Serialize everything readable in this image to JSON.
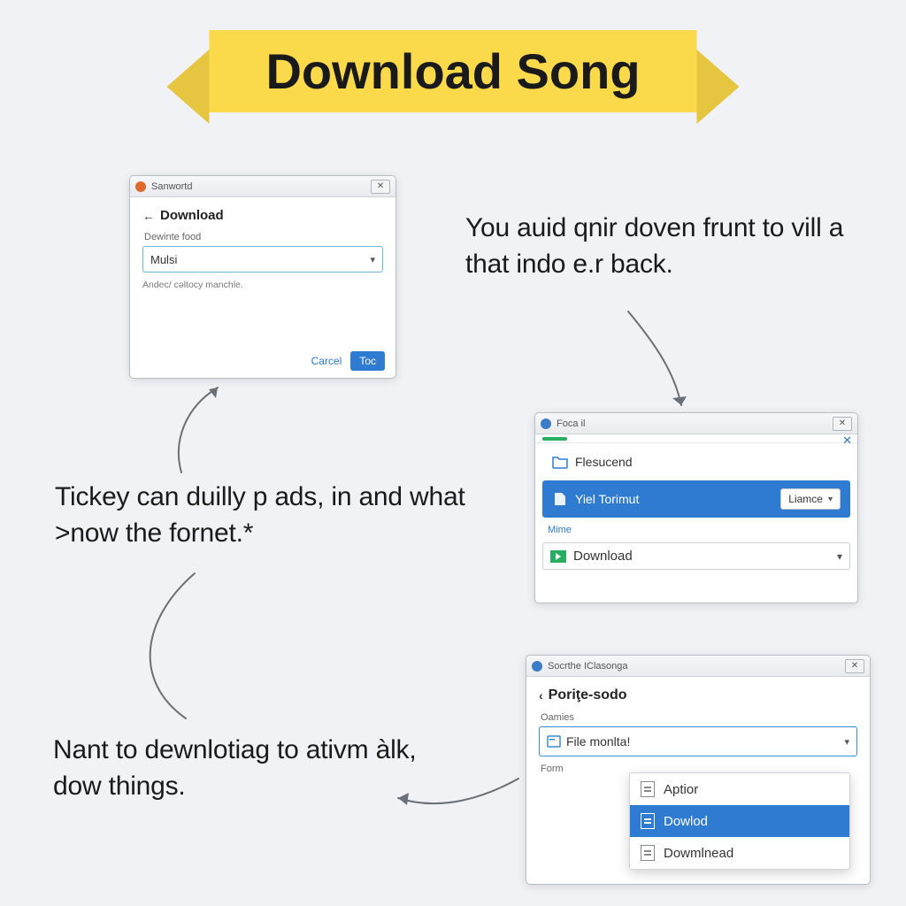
{
  "banner": {
    "title": "Download Song"
  },
  "captions": {
    "c1": "You auid qnir doven frunt to vill a that indo e.r back.",
    "c2": "Tickey can duilly p ads, in and what >now the fornet.*",
    "c3": "Nant to dewnlotiag to ativm àlk, dow things."
  },
  "win1": {
    "app_title": "Sanwortd",
    "back_label": "Download",
    "field_label": "Dewinte food",
    "select_value": "Mulsi",
    "hint": "Andec/ cəltocy manchle.",
    "cancel_label": "Carcel",
    "ok_label": "Toc"
  },
  "win2": {
    "app_title": "Foca il",
    "row1_label": "Flesucend",
    "row2_label": "Yiel Torimut",
    "chip_label": "Liamce",
    "link_label": "Mime",
    "download_label": "Download"
  },
  "win3": {
    "app_title": "Socrthe IClasonga",
    "crumb_label": "Poriţe-sodo",
    "field1_label": "Oamies",
    "select_value": "File monlta!",
    "field2_label": "Form",
    "options": [
      {
        "label": "Aptior"
      },
      {
        "label": "Dowlod"
      },
      {
        "label": "Dowmlnead"
      }
    ],
    "selected_index": 1
  }
}
